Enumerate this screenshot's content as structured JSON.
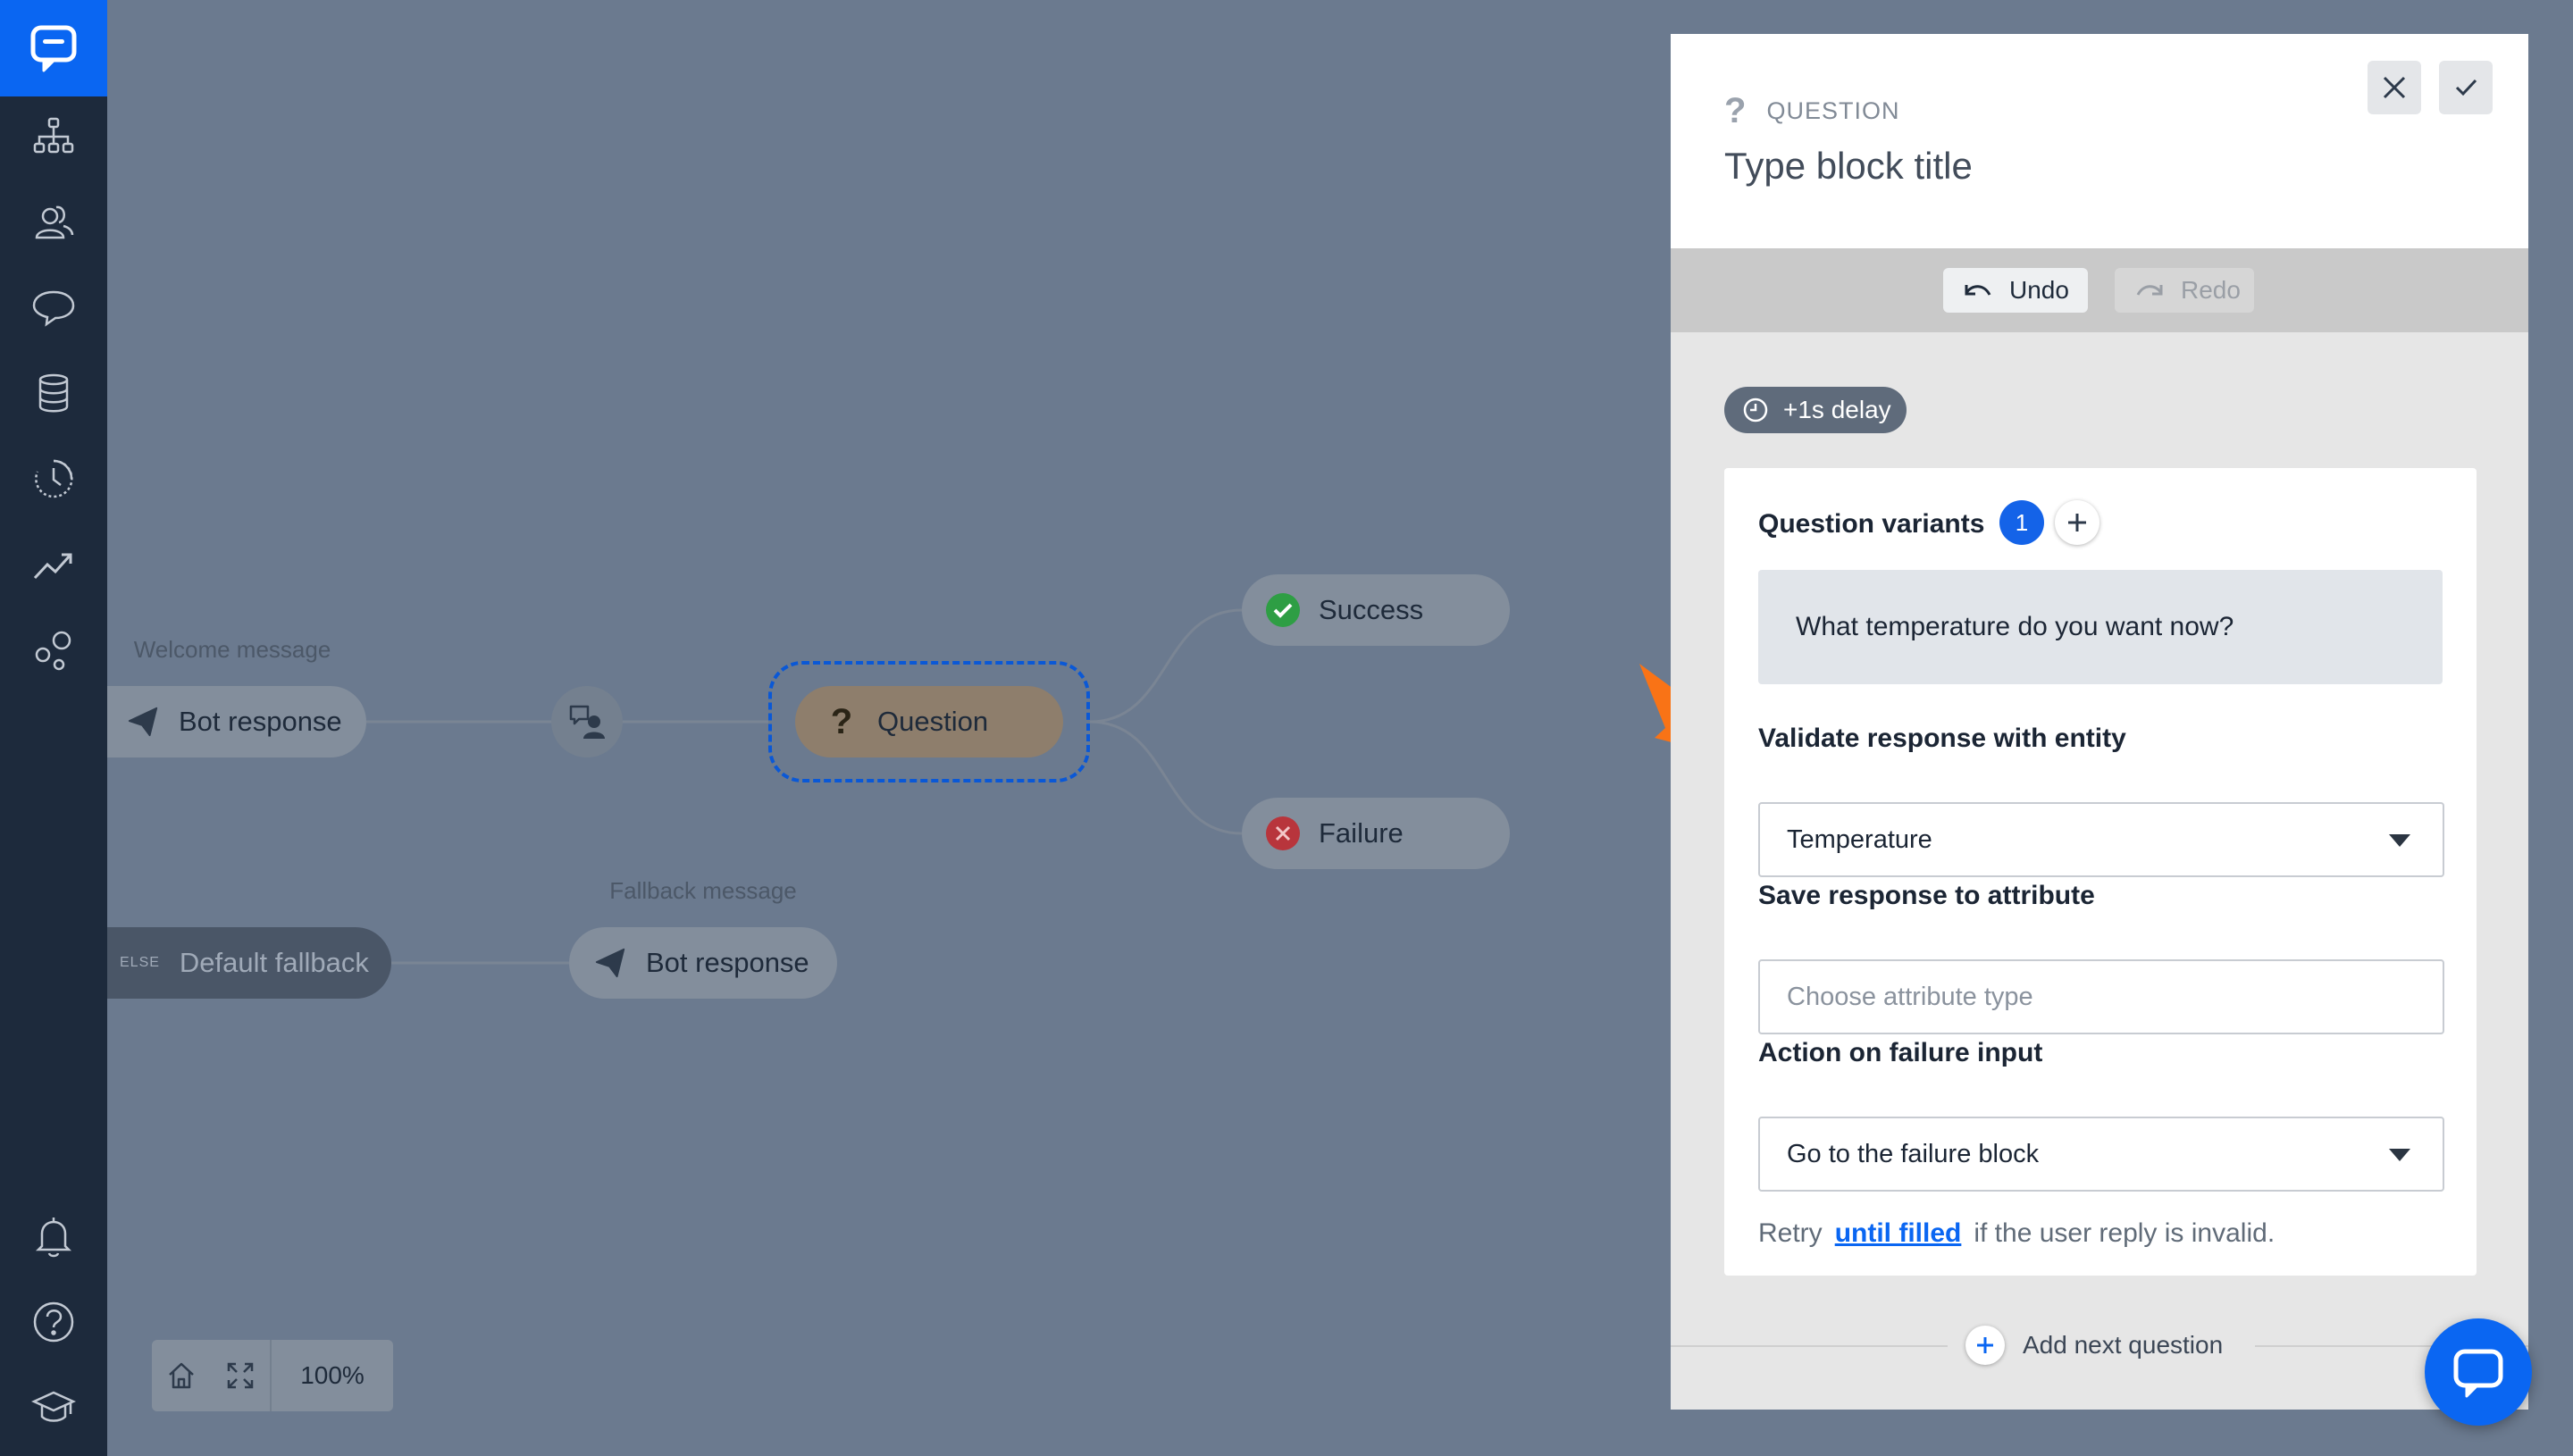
{
  "sidebar": {
    "items": [
      {
        "icon": "flow-tree-icon"
      },
      {
        "icon": "users-icon"
      },
      {
        "icon": "chat-bubble-icon"
      },
      {
        "icon": "database-icon"
      },
      {
        "icon": "history-icon"
      },
      {
        "icon": "trend-icon"
      },
      {
        "icon": "integrations-icon"
      }
    ],
    "bottom_items": [
      {
        "icon": "bell-icon"
      },
      {
        "icon": "help-icon"
      },
      {
        "icon": "graduation-cap-icon"
      }
    ]
  },
  "canvas": {
    "welcome_caption": "Welcome message",
    "welcome_node": "Bot response",
    "question_node": "Question",
    "success_node": "Success",
    "failure_node": "Failure",
    "fallback_caption": "Fallback message",
    "fallback_default_tag": "ELSE",
    "fallback_default": "Default fallback",
    "fallback_node": "Bot response",
    "zoom_level": "100%"
  },
  "panel": {
    "block_type": "QUESTION",
    "title_placeholder": "Type block title",
    "undo_label": "Undo",
    "redo_label": "Redo",
    "delay_label": "+1s delay",
    "variants_label": "Question variants",
    "variants_count": "1",
    "variant_text": "What temperature do you want now?",
    "validate_label": "Validate response with entity",
    "validate_value": "Temperature",
    "save_label": "Save response to attribute",
    "save_placeholder": "Choose attribute type",
    "failure_label": "Action on failure input",
    "failure_value": "Go to the failure block",
    "retry_prefix": "Retry",
    "retry_link": "until filled",
    "retry_suffix": "if the user reply is invalid.",
    "add_next_label": "Add next question"
  },
  "colors": {
    "brand": "#0a66f2",
    "sidebar": "#1d2a3c",
    "success": "#2e9e44",
    "failure": "#c8323b",
    "highlight_arrow": "#f97316"
  }
}
